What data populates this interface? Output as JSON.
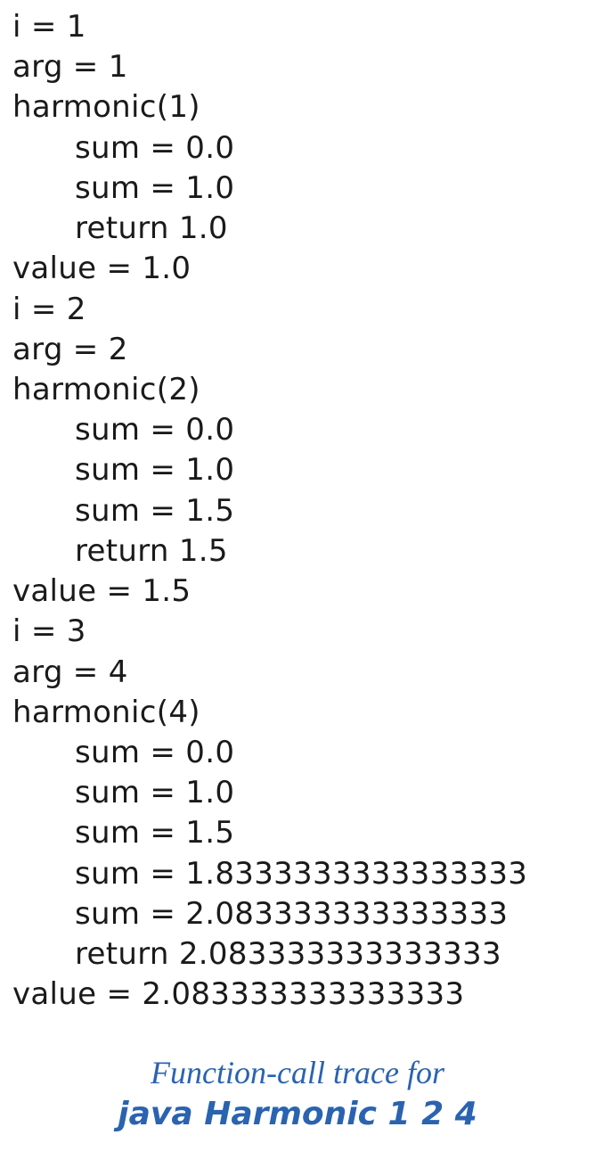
{
  "trace": {
    "lines": [
      {
        "indent": 0,
        "text": "i = 1"
      },
      {
        "indent": 0,
        "text": "arg = 1"
      },
      {
        "indent": 0,
        "text": "harmonic(1)"
      },
      {
        "indent": 1,
        "text": "sum = 0.0"
      },
      {
        "indent": 1,
        "text": "sum = 1.0"
      },
      {
        "indent": 1,
        "text": "return 1.0"
      },
      {
        "indent": 0,
        "text": "value = 1.0"
      },
      {
        "indent": 0,
        "text": "i = 2"
      },
      {
        "indent": 0,
        "text": "arg = 2"
      },
      {
        "indent": 0,
        "text": "harmonic(2)"
      },
      {
        "indent": 1,
        "text": "sum = 0.0"
      },
      {
        "indent": 1,
        "text": "sum = 1.0"
      },
      {
        "indent": 1,
        "text": "sum = 1.5"
      },
      {
        "indent": 1,
        "text": "return 1.5"
      },
      {
        "indent": 0,
        "text": "value = 1.5"
      },
      {
        "indent": 0,
        "text": "i = 3"
      },
      {
        "indent": 0,
        "text": "arg = 4"
      },
      {
        "indent": 0,
        "text": "harmonic(4)"
      },
      {
        "indent": 1,
        "text": "sum = 0.0"
      },
      {
        "indent": 1,
        "text": "sum = 1.0"
      },
      {
        "indent": 1,
        "text": "sum = 1.5"
      },
      {
        "indent": 1,
        "text": "sum = 1.8333333333333333"
      },
      {
        "indent": 1,
        "text": "sum = 2.083333333333333"
      },
      {
        "indent": 1,
        "text": "return 2.083333333333333"
      },
      {
        "indent": 0,
        "text": "value = 2.083333333333333"
      }
    ]
  },
  "caption": {
    "line1": "Function-call trace for",
    "line2": "java Harmonic 1 2 4"
  },
  "colors": {
    "text": "#1a1a1a",
    "caption": "#2a63b0"
  }
}
